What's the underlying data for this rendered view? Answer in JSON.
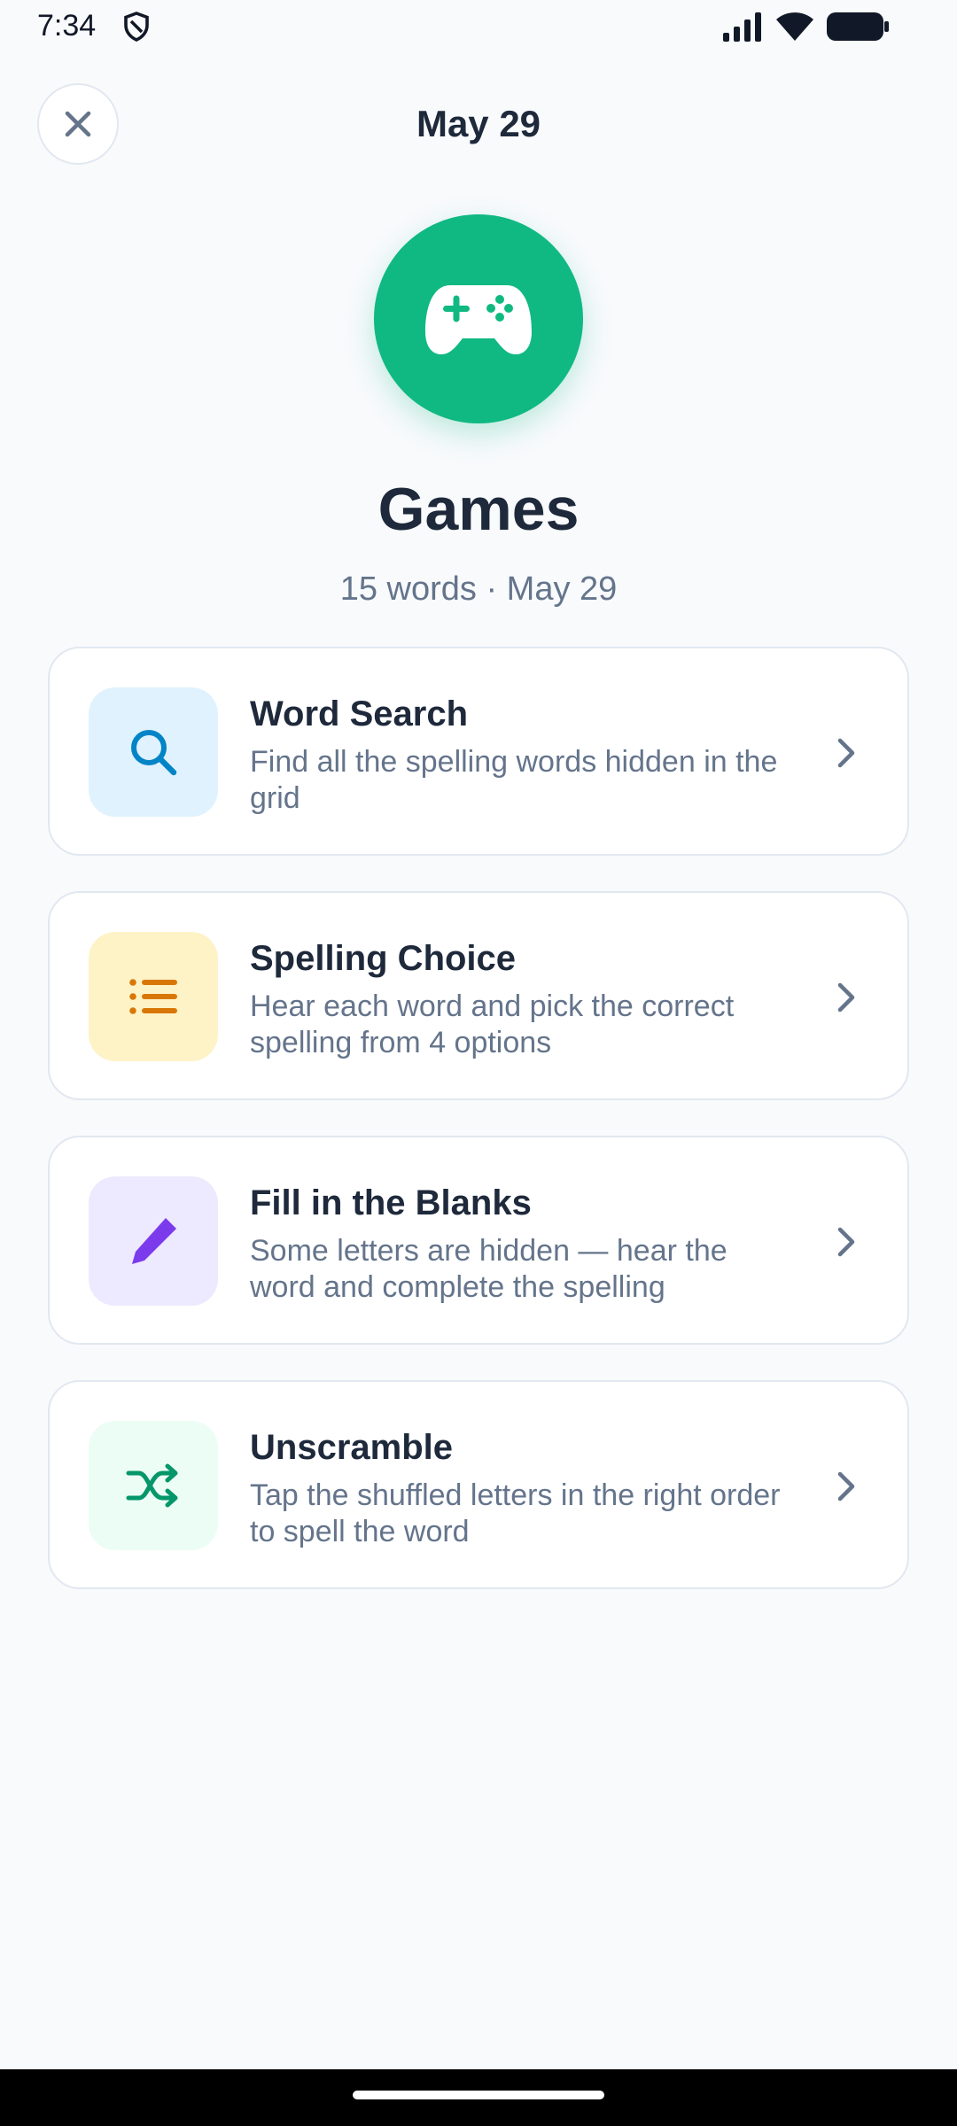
{
  "status_bar": {
    "time": "7:34"
  },
  "header": {
    "title": "May 29"
  },
  "hero": {
    "title": "Games",
    "subtitle": "15 words · May 29"
  },
  "games": [
    {
      "title": "Word Search",
      "description": "Find all the spelling words hidden in the grid",
      "icon": "search-icon",
      "bg": "#E0F2FE",
      "color": "#0284C7"
    },
    {
      "title": "Spelling Choice",
      "description": "Hear each word and pick the correct spelling from 4 options",
      "icon": "list-icon",
      "bg": "#FEF3C7",
      "color": "#D97706"
    },
    {
      "title": "Fill in the Blanks",
      "description": "Some letters are hidden — hear the word and complete the spelling",
      "icon": "pencil-icon",
      "bg": "#EDE9FE",
      "color": "#7C3AED"
    },
    {
      "title": "Unscramble",
      "description": "Tap the shuffled letters in the right order to spell the word",
      "icon": "shuffle-icon",
      "bg": "#ECFDF5",
      "color": "#059669"
    }
  ],
  "colors": {
    "accent": "#10B981",
    "background": "#F8FAFC",
    "text": "#1E293B",
    "muted": "#64748B"
  }
}
